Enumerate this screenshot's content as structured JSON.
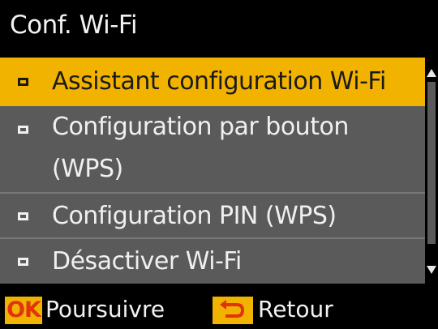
{
  "header": {
    "title": "Conf. Wi-Fi"
  },
  "menu": {
    "items": [
      {
        "lines": [
          "Assistant configuration Wi-Fi"
        ],
        "selected": true
      },
      {
        "lines": [
          "Configuration par bouton",
          "(WPS)"
        ],
        "selected": false
      },
      {
        "lines": [
          "Configuration PIN (WPS)"
        ],
        "selected": false
      },
      {
        "lines": [
          "Désactiver Wi-Fi"
        ],
        "selected": false
      }
    ]
  },
  "footer": {
    "ok_key": "OK",
    "ok_label": "Poursuivre",
    "back_icon": "back-arrow-icon",
    "back_label": "Retour"
  },
  "colors": {
    "highlight": "#f2b300",
    "list_bg": "#5a5a5a",
    "ok_text": "#e0340f",
    "background": "#000000"
  }
}
